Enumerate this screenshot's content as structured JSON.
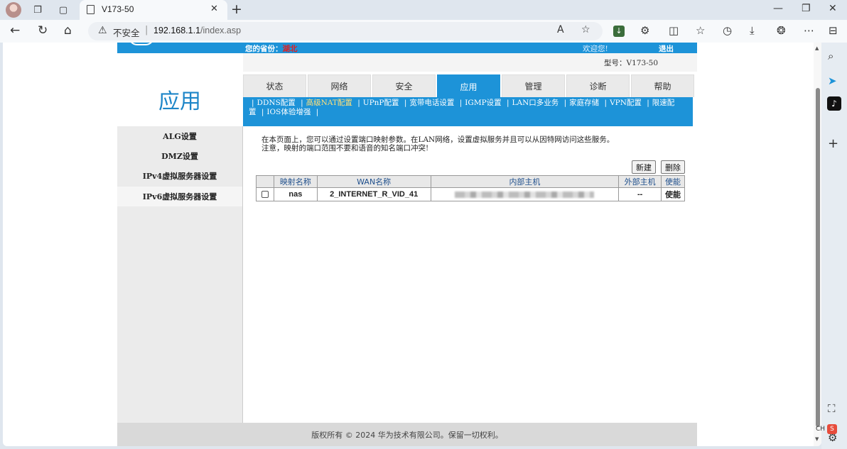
{
  "browser": {
    "tab_title": "V173-50",
    "insecure_label": "不安全",
    "url_host": "192.168.1.1",
    "url_path": "/index.asp",
    "ime_label": "CH",
    "ime_icon_label": "S"
  },
  "header": {
    "province_label": "您的省份：",
    "province_value": "湖北",
    "welcome": "欢迎您!",
    "logout": "退出",
    "model": "型号：V173-50"
  },
  "app_title": "应用",
  "main_tabs": [
    "状态",
    "网络",
    "安全",
    "应用",
    "管理",
    "诊断",
    "帮助"
  ],
  "sub_nav": {
    "line1": [
      "DDNS配置",
      "高级NAT配置",
      "UPnP配置",
      "宽带电话设置",
      "IGMP设置",
      "LAN口多业务",
      "家庭存储",
      "VPN配置",
      "限速配"
    ],
    "line2_prefix": "置",
    "line2": [
      "IOS体验增强"
    ]
  },
  "left_menu": [
    "ALG设置",
    "DMZ设置",
    "IPv4虚拟服务器设置",
    "IPv6虚拟服务器设置"
  ],
  "content": {
    "intro_line1": "在本页面上，您可以通过设置端口映射参数。在LAN网络，设置虚拟服务并且可以从因特网访问这些服务。",
    "intro_line2": "注意，映射的端口范围不要和语音的知名端口冲突!",
    "new_button": "新建",
    "delete_button": "删除",
    "table_headers": [
      "映射名称",
      "WAN名称",
      "内部主机",
      "外部主机",
      "使能"
    ],
    "rows": [
      {
        "name": "nas",
        "wan": "2_INTERNET_R_VID_41",
        "external": "--",
        "enable": "使能"
      }
    ]
  },
  "footer": "版权所有 © 2024 华为技术有限公司。保留一切权利。",
  "icons": {
    "warning": "warning-icon",
    "favorite": "star-icon"
  }
}
